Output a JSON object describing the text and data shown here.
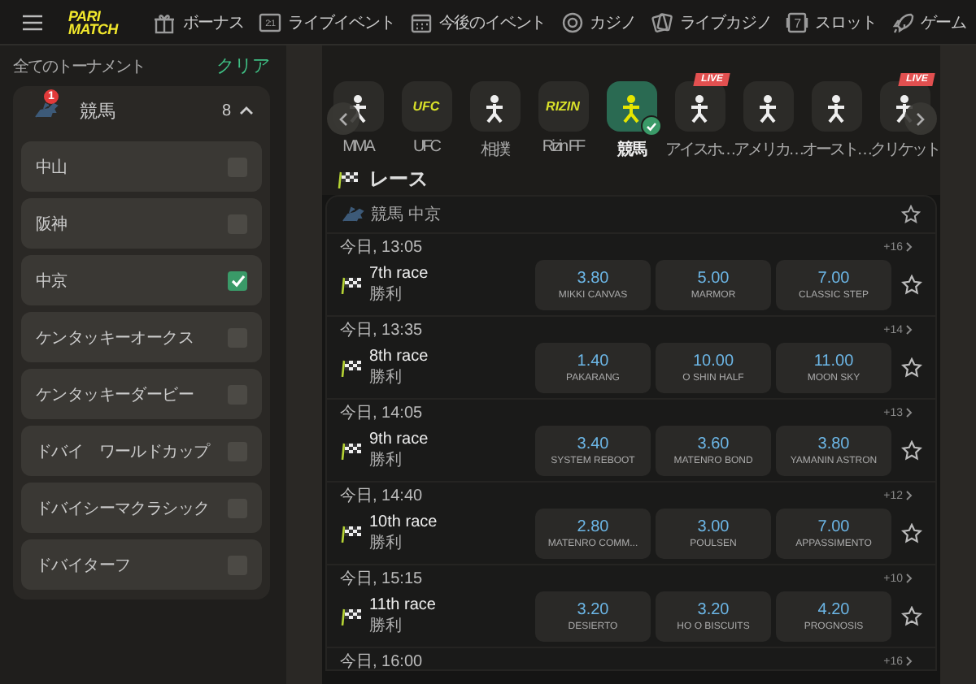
{
  "header": {
    "logo": [
      "PARI",
      "MATCH"
    ],
    "nav": [
      {
        "label": "ボーナス",
        "kind": "gift"
      },
      {
        "label": "ライブイベント",
        "kind": "score",
        "icon_text": "2:1"
      },
      {
        "label": "今後のイベント",
        "kind": "calendar"
      },
      {
        "label": "カジノ",
        "kind": "chip"
      },
      {
        "label": "ライブカジノ",
        "kind": "cards"
      },
      {
        "label": "スロット",
        "kind": "slot",
        "icon_text": "7"
      },
      {
        "label": "ゲーム",
        "kind": "rocket"
      }
    ]
  },
  "sidebar": {
    "title": "全てのトーナメント",
    "clear": "クリア",
    "group": {
      "label": "競馬",
      "badge": "1",
      "count": "8",
      "expanded": true,
      "items": [
        {
          "label": "中山",
          "checked": false
        },
        {
          "label": "阪神",
          "checked": false
        },
        {
          "label": "中京",
          "checked": true
        },
        {
          "label": "ケンタッキーオークス",
          "checked": false
        },
        {
          "label": "ケンタッキーダービー",
          "checked": false
        },
        {
          "label": "ドバイ　ワールドカップ",
          "checked": false
        },
        {
          "label": "ドバイシーマクラシック",
          "checked": false
        },
        {
          "label": "ドバイターフ",
          "checked": false
        }
      ]
    }
  },
  "sports": [
    {
      "label": "MMA",
      "kind": "figure",
      "selected": false,
      "live": false
    },
    {
      "label": "UFC",
      "kind": "logo",
      "logo_text": "UFC",
      "selected": false,
      "live": false
    },
    {
      "label": "相撲",
      "kind": "figure",
      "selected": false,
      "live": false
    },
    {
      "label": "Rizin FF",
      "kind": "logo",
      "logo_text": "RIZIN",
      "selected": false,
      "live": false
    },
    {
      "label": "競馬",
      "kind": "figure",
      "selected": true,
      "live": false
    },
    {
      "label": "アイスホ…",
      "kind": "figure",
      "selected": false,
      "live": true,
      "live_text": "LIVE"
    },
    {
      "label": "アメリカ…",
      "kind": "figure",
      "selected": false,
      "live": false
    },
    {
      "label": "オースト…",
      "kind": "figure",
      "selected": false,
      "live": false
    },
    {
      "label": "クリケット",
      "kind": "figure",
      "selected": false,
      "live": true,
      "live_text": "LIVE"
    }
  ],
  "section_title": "レース",
  "league": "競馬 中京",
  "races": [
    {
      "time": "今日, 13:05",
      "more": "+16",
      "name": "7th race",
      "market": "勝利",
      "odds": [
        {
          "price": "3.80",
          "runner": "MIKKI CANVAS"
        },
        {
          "price": "5.00",
          "runner": "MARMOR"
        },
        {
          "price": "7.00",
          "runner": "CLASSIC STEP"
        }
      ]
    },
    {
      "time": "今日, 13:35",
      "more": "+14",
      "name": "8th race",
      "market": "勝利",
      "odds": [
        {
          "price": "1.40",
          "runner": "PAKARANG"
        },
        {
          "price": "10.00",
          "runner": "O SHIN HALF"
        },
        {
          "price": "11.00",
          "runner": "MOON SKY"
        }
      ]
    },
    {
      "time": "今日, 14:05",
      "more": "+13",
      "name": "9th race",
      "market": "勝利",
      "odds": [
        {
          "price": "3.40",
          "runner": "SYSTEM REBOOT"
        },
        {
          "price": "3.60",
          "runner": "MATENRO BOND"
        },
        {
          "price": "3.80",
          "runner": "YAMANIN ASTRON"
        }
      ]
    },
    {
      "time": "今日, 14:40",
      "more": "+12",
      "name": "10th race",
      "market": "勝利",
      "odds": [
        {
          "price": "2.80",
          "runner": "MATENRO COMM..."
        },
        {
          "price": "3.00",
          "runner": "POULSEN"
        },
        {
          "price": "7.00",
          "runner": "APPASSIMENTO"
        }
      ]
    },
    {
      "time": "今日, 15:15",
      "more": "+10",
      "name": "11th race",
      "market": "勝利",
      "odds": [
        {
          "price": "3.20",
          "runner": "DESIERTO"
        },
        {
          "price": "3.20",
          "runner": "HO O BISCUITS"
        },
        {
          "price": "4.20",
          "runner": "PROGNOSIS"
        }
      ]
    },
    {
      "time": "今日, 16:00",
      "more": "+16"
    }
  ]
}
